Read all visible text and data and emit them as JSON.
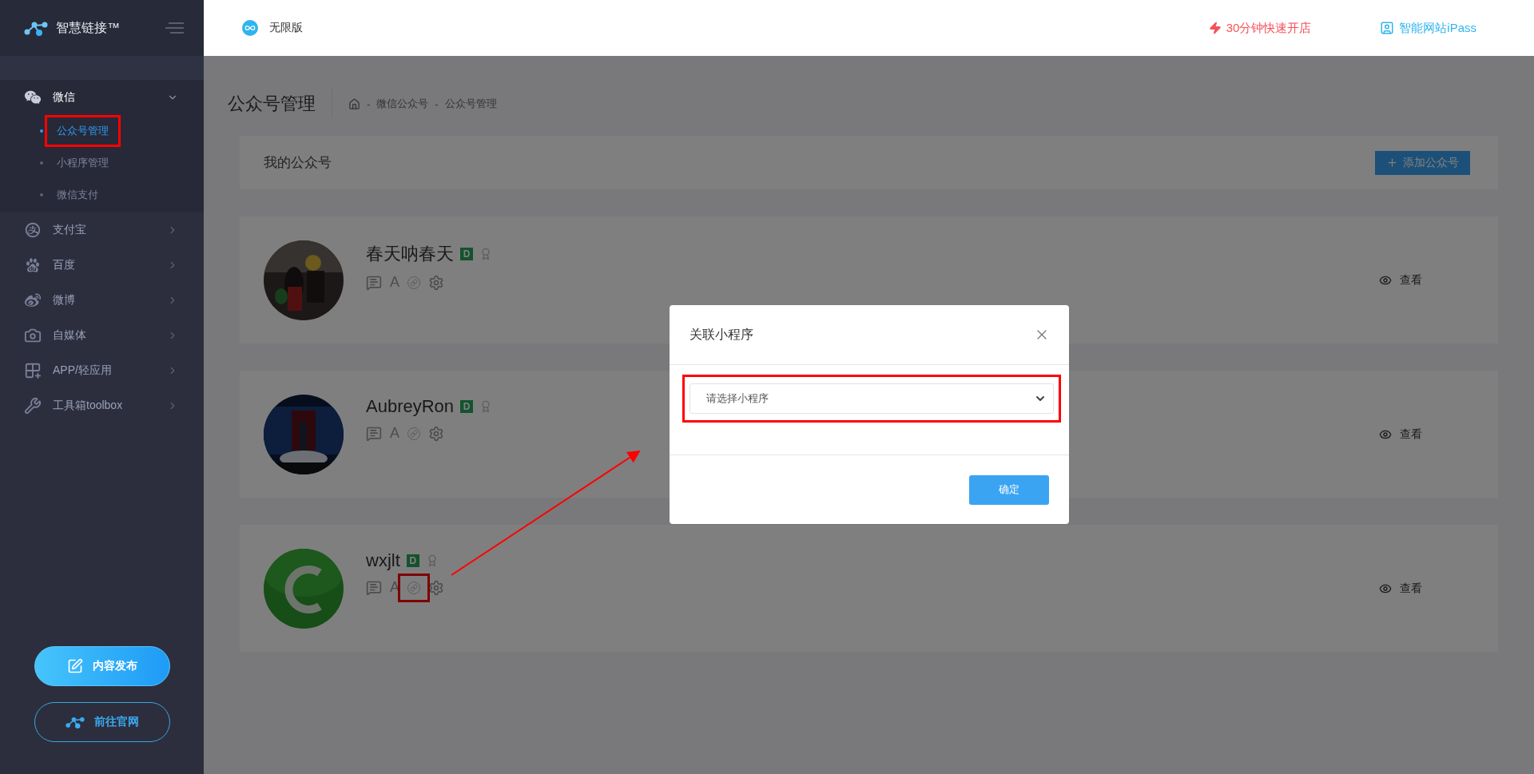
{
  "sidebar": {
    "brand": "智慧链接™",
    "menu": [
      {
        "label": "微信",
        "kind": "wechat",
        "expanded": true,
        "children": [
          {
            "label": "公众号管理",
            "selected": true,
            "highlighted": true
          },
          {
            "label": "小程序管理",
            "selected": false,
            "highlighted": false
          },
          {
            "label": "微信支付",
            "selected": false,
            "highlighted": false
          }
        ]
      },
      {
        "label": "支付宝",
        "kind": "alipay",
        "expanded": false
      },
      {
        "label": "百度",
        "kind": "baidu",
        "expanded": false
      },
      {
        "label": "微博",
        "kind": "weibo",
        "expanded": false
      },
      {
        "label": "自媒体",
        "kind": "media",
        "expanded": false
      },
      {
        "label": "APP/轻应用",
        "kind": "apps",
        "expanded": false
      },
      {
        "label": "工具箱toolbox",
        "kind": "tools",
        "expanded": false
      }
    ],
    "buttons": [
      {
        "kind": "primary",
        "label": "内容发布"
      },
      {
        "kind": "outline",
        "label": "前往官网"
      }
    ]
  },
  "header": {
    "edition": "无限版",
    "links": [
      {
        "kind": "shop",
        "label": "30分钟快速开店",
        "color": "#f5525a"
      },
      {
        "kind": "site",
        "label": "智能网站iPass",
        "color": "#2fb4f0"
      }
    ]
  },
  "page": {
    "title": "公众号管理",
    "breadcrumb_separator": "-",
    "breadcrumb": [
      "微信公众号",
      "公众号管理"
    ]
  },
  "panel": {
    "title": "我的公众号",
    "add_button": "添加公众号"
  },
  "accounts": [
    {
      "name": "春天呐春天",
      "badge": "D",
      "font_icon": "A",
      "link_highlighted": false,
      "view": "查看"
    },
    {
      "name": "AubreyRon",
      "badge": "D",
      "font_icon": "A",
      "link_highlighted": false,
      "view": "查看"
    },
    {
      "name": "wxjlt",
      "badge": "D",
      "font_icon": "A",
      "link_highlighted": true,
      "view": "查看"
    }
  ],
  "modal": {
    "title": "关联小程序",
    "select": {
      "placeholder": "请选择小程序",
      "highlighted": true
    },
    "confirm": "确定"
  }
}
